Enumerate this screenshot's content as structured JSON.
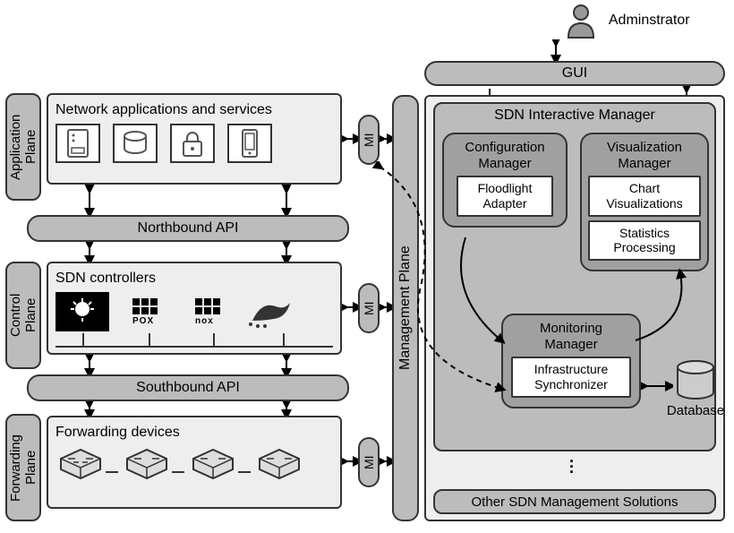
{
  "planes": {
    "application": "Application\nPlane",
    "control": "Control\nPlane",
    "forwarding": "Forwarding\nPlane",
    "management": "Management Plane"
  },
  "apis": {
    "northbound": "Northbound API",
    "southbound": "Southbound API"
  },
  "appPlane": {
    "title": "Network applications and services"
  },
  "controlPlane": {
    "title": "SDN controllers",
    "controllers": [
      "",
      "POX",
      "nox",
      ""
    ]
  },
  "forwardingPlane": {
    "title": "Forwarding devices"
  },
  "mi": "MI",
  "admin": "Adminstrator",
  "gui": "GUI",
  "sdnInteractive": {
    "title": "SDN Interactive Manager",
    "configManager": {
      "title": "Configuration\nManager",
      "sub": "Floodlight\nAdapter"
    },
    "vizManager": {
      "title": "Visualization\nManager",
      "sub1": "Chart\nVisualizations",
      "sub2": "Statistics\nProcessing"
    },
    "monitorManager": {
      "title": "Monitoring\nManager",
      "sub": "Infrastructure\nSynchronizer"
    }
  },
  "database": "Database",
  "otherSolutions": "Other SDN Management Solutions"
}
